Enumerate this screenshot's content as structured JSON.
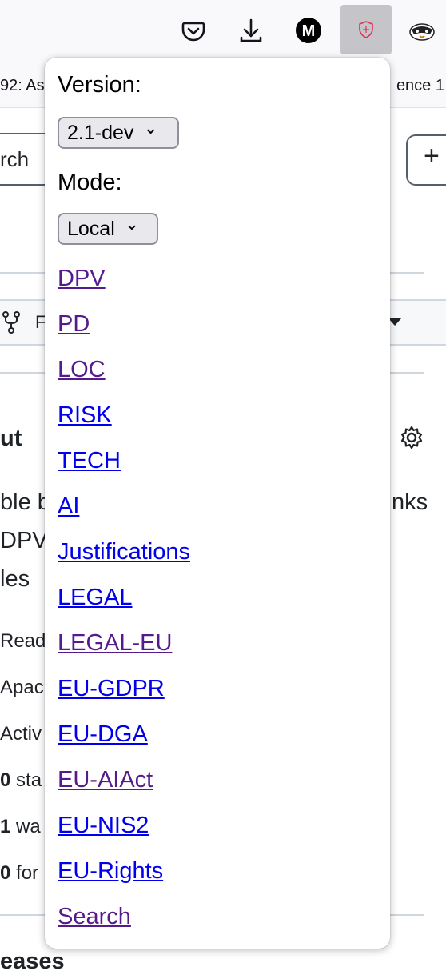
{
  "toolbar": {
    "icons": [
      "pocket-icon",
      "download-icon",
      "medium-extension-icon",
      "dpv-extension-icon",
      "privacy-badger-icon"
    ]
  },
  "tabstrip": {
    "left_text": "92: As",
    "right_text": "ence 1"
  },
  "background": {
    "search_fragment": "rch",
    "plus_label": "+",
    "fork_fragment": "F",
    "about_heading": "ut",
    "desc_line1_left": "ble b",
    "desc_line1_right": "nks",
    "desc_line2": "DPV",
    "desc_line3": "les",
    "meta_readme": "Read",
    "meta_license": "Apac",
    "meta_activity": "Activ",
    "stars_count": "0",
    "stars_label": "sta",
    "watch_count": "1",
    "watch_label": "wa",
    "forks_count": "0",
    "forks_label": "for",
    "releases_heading": "eases"
  },
  "popup": {
    "version_label": "Version:",
    "version_value": "2.1-dev",
    "mode_label": "Mode:",
    "mode_value": "Local",
    "links": [
      {
        "label": "DPV",
        "visited": true
      },
      {
        "label": "PD",
        "visited": true
      },
      {
        "label": "LOC",
        "visited": true
      },
      {
        "label": "RISK",
        "visited": false
      },
      {
        "label": "TECH",
        "visited": false
      },
      {
        "label": "AI",
        "visited": false
      },
      {
        "label": "Justifications",
        "visited": false
      },
      {
        "label": "LEGAL",
        "visited": false
      },
      {
        "label": "LEGAL-EU",
        "visited": true
      },
      {
        "label": "EU-GDPR",
        "visited": false
      },
      {
        "label": "EU-DGA",
        "visited": false
      },
      {
        "label": "EU-AIAct",
        "visited": true
      },
      {
        "label": "EU-NIS2",
        "visited": false
      },
      {
        "label": "EU-Rights",
        "visited": false
      },
      {
        "label": "Search",
        "visited": true
      }
    ]
  },
  "colors": {
    "visited_link": "#551a8b",
    "unvisited_link": "#0000ee",
    "accent_shield": "#e0315a"
  }
}
